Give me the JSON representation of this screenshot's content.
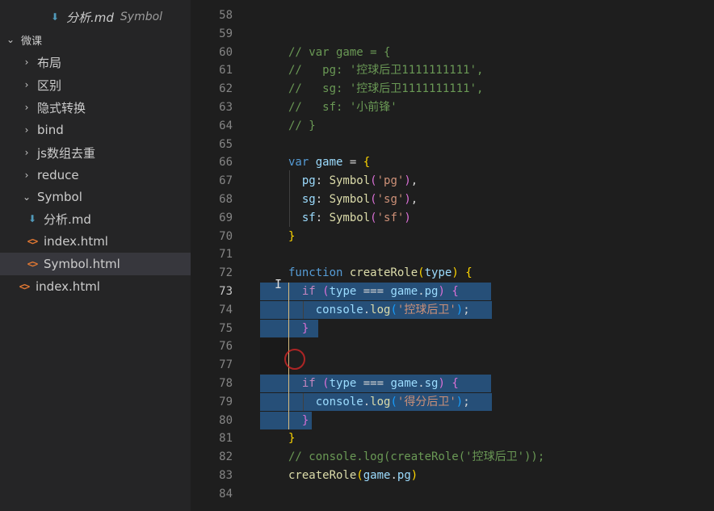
{
  "sidebar": {
    "top_item": {
      "name": "分析.md",
      "description": "Symbol"
    },
    "folder": {
      "label": "微课"
    },
    "items": [
      {
        "label": "布局"
      },
      {
        "label": "区别"
      },
      {
        "label": "隐式转换"
      },
      {
        "label": "bind"
      },
      {
        "label": "js数组去重"
      },
      {
        "label": "reduce"
      },
      {
        "label": "Symbol"
      }
    ],
    "symbol_children": [
      {
        "label": "分析.md"
      },
      {
        "label": "index.html"
      },
      {
        "label": "Symbol.html"
      }
    ],
    "root_file": {
      "label": "index.html"
    }
  },
  "editor": {
    "active_line": "73",
    "lines": [
      {
        "n": "58"
      },
      {
        "n": "59"
      },
      {
        "n": "60",
        "tokens": [
          [
            "com",
            "// var game = {"
          ]
        ]
      },
      {
        "n": "61",
        "tokens": [
          [
            "com",
            "//   pg: '控球后卫1111111111',"
          ]
        ]
      },
      {
        "n": "62",
        "tokens": [
          [
            "com",
            "//   sg: '控球后卫1111111111',"
          ]
        ]
      },
      {
        "n": "63",
        "tokens": [
          [
            "com",
            "//   sf: '小前锋'"
          ]
        ]
      },
      {
        "n": "64",
        "tokens": [
          [
            "com",
            "// }"
          ]
        ]
      },
      {
        "n": "65"
      },
      {
        "n": "66",
        "tokens": [
          [
            "kw",
            "var "
          ],
          [
            "var",
            "game"
          ],
          [
            "",
            " = "
          ],
          [
            "br1",
            "{"
          ]
        ]
      },
      {
        "n": "67",
        "tokens": [
          [
            "",
            "  "
          ],
          [
            "var",
            "pg"
          ],
          [
            "",
            ": "
          ],
          [
            "fn",
            "Symbol"
          ],
          [
            "br2",
            "("
          ],
          [
            "str",
            "'pg'"
          ],
          [
            "br2",
            ")"
          ],
          [
            "",
            ","
          ]
        ]
      },
      {
        "n": "68",
        "tokens": [
          [
            "",
            "  "
          ],
          [
            "var",
            "sg"
          ],
          [
            "",
            ": "
          ],
          [
            "fn",
            "Symbol"
          ],
          [
            "br2",
            "("
          ],
          [
            "str",
            "'sg'"
          ],
          [
            "br2",
            ")"
          ],
          [
            "",
            ","
          ]
        ]
      },
      {
        "n": "69",
        "tokens": [
          [
            "",
            "  "
          ],
          [
            "var",
            "sf"
          ],
          [
            "",
            ": "
          ],
          [
            "fn",
            "Symbol"
          ],
          [
            "br2",
            "("
          ],
          [
            "str",
            "'sf'"
          ],
          [
            "br2",
            ")"
          ]
        ]
      },
      {
        "n": "70",
        "tokens": [
          [
            "br1",
            "}"
          ]
        ]
      },
      {
        "n": "71"
      },
      {
        "n": "72",
        "tokens": [
          [
            "kw",
            "function "
          ],
          [
            "fn",
            "createRole"
          ],
          [
            "br1",
            "("
          ],
          [
            "var",
            "type"
          ],
          [
            "br1",
            ")"
          ],
          [
            "",
            " "
          ],
          [
            "br1",
            "{"
          ]
        ]
      },
      {
        "n": "73",
        "tokens": [
          [
            "",
            "  "
          ],
          [
            "ctl",
            "if"
          ],
          [
            "",
            " "
          ],
          [
            "br2",
            "("
          ],
          [
            "var",
            "type"
          ],
          [
            "",
            " === "
          ],
          [
            "var",
            "game"
          ],
          [
            "",
            "."
          ],
          [
            "var",
            "pg"
          ],
          [
            "br2",
            ")"
          ],
          [
            "",
            " "
          ],
          [
            "br2",
            "{"
          ]
        ]
      },
      {
        "n": "74",
        "tokens": [
          [
            "",
            "    "
          ],
          [
            "var",
            "console"
          ],
          [
            "",
            "."
          ],
          [
            "fn",
            "log"
          ],
          [
            "br3",
            "("
          ],
          [
            "str",
            "'控球后卫'"
          ],
          [
            "br3",
            ")"
          ],
          [
            "",
            ";"
          ]
        ]
      },
      {
        "n": "75",
        "tokens": [
          [
            "",
            "  "
          ],
          [
            "br2",
            "}"
          ]
        ]
      },
      {
        "n": "76"
      },
      {
        "n": "77"
      },
      {
        "n": "78",
        "tokens": [
          [
            "",
            "  "
          ],
          [
            "ctl",
            "if"
          ],
          [
            "",
            " "
          ],
          [
            "br2",
            "("
          ],
          [
            "var",
            "type"
          ],
          [
            "",
            " === "
          ],
          [
            "var",
            "game"
          ],
          [
            "",
            "."
          ],
          [
            "var",
            "sg"
          ],
          [
            "br2",
            ")"
          ],
          [
            "",
            " "
          ],
          [
            "br2",
            "{"
          ]
        ]
      },
      {
        "n": "79",
        "tokens": [
          [
            "",
            "    "
          ],
          [
            "var",
            "console"
          ],
          [
            "",
            "."
          ],
          [
            "fn",
            "log"
          ],
          [
            "br3",
            "("
          ],
          [
            "str",
            "'得分后卫'"
          ],
          [
            "br3",
            ")"
          ],
          [
            "",
            ";"
          ]
        ]
      },
      {
        "n": "80",
        "tokens": [
          [
            "",
            "  "
          ],
          [
            "br2",
            "}"
          ]
        ]
      },
      {
        "n": "81",
        "tokens": [
          [
            "br1",
            "}"
          ]
        ]
      },
      {
        "n": "82",
        "tokens": [
          [
            "com",
            "// console.log(createRole('控球后卫'));"
          ]
        ]
      },
      {
        "n": "83",
        "tokens": [
          [
            "fn",
            "createRole"
          ],
          [
            "br1",
            "("
          ],
          [
            "var",
            "game"
          ],
          [
            "",
            "."
          ],
          [
            "var",
            "pg"
          ],
          [
            "br1",
            ")"
          ]
        ]
      },
      {
        "n": "84"
      }
    ]
  }
}
